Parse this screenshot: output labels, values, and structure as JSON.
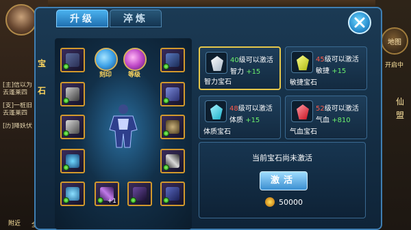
{
  "tabs": [
    {
      "label": "升级",
      "active": true
    },
    {
      "label": "淬炼",
      "active": false
    }
  ],
  "side_label": [
    "宝",
    "石"
  ],
  "orbs": [
    {
      "label": "刻印",
      "color": "#3fa3e8"
    },
    {
      "label": "等级",
      "color": "#c04ac8"
    }
  ],
  "equipment_slots": [
    {
      "name": "helmet",
      "plus": ""
    },
    {
      "name": "necklace",
      "plus": ""
    },
    {
      "name": "flag",
      "plus": ""
    },
    {
      "name": "shoulder",
      "plus": ""
    },
    {
      "name": "banner",
      "plus": ""
    },
    {
      "name": "mask",
      "plus": ""
    },
    {
      "name": "ring",
      "plus": ""
    },
    {
      "name": "sword",
      "plus": ""
    },
    {
      "name": "orb-charm",
      "plus": ""
    },
    {
      "name": "staff",
      "plus": "+1"
    },
    {
      "name": "bow",
      "plus": ""
    },
    {
      "name": "boots",
      "plus": ""
    }
  ],
  "gems": [
    {
      "name": "智力宝石",
      "level": "40",
      "condition_suffix": "级可以激活",
      "stat": "智力",
      "bonus": "+15",
      "color": "#d8e6f2",
      "level_color": "green",
      "selected": true
    },
    {
      "name": "敏捷宝石",
      "level": "45",
      "condition_suffix": "级可以激活",
      "stat": "敏捷",
      "bonus": "+15",
      "color": "#e8ec3a",
      "level_color": "red",
      "selected": false
    },
    {
      "name": "体质宝石",
      "level": "48",
      "condition_suffix": "级可以激活",
      "stat": "体质",
      "bonus": "+15",
      "color": "#3ad8e8",
      "level_color": "red",
      "selected": false
    },
    {
      "name": "气血宝石",
      "level": "52",
      "condition_suffix": "级可以激活",
      "stat": "气血",
      "bonus": "+810",
      "color": "#e8243a",
      "level_color": "red",
      "selected": false
    }
  ],
  "info": {
    "status": "当前宝石尚未激活",
    "activate_label": "激活",
    "cost": "50000"
  },
  "hud": {
    "chat": [
      {
        "tag": "[主]",
        "text": "信以为"
      },
      {
        "tag": "",
        "text": "去蓬莱四"
      },
      {
        "tag": "[支]",
        "text": "一桩旧"
      },
      {
        "tag": "",
        "text": "去蓬莱四"
      },
      {
        "tag": "[历]",
        "text": "降妖伏"
      }
    ],
    "bottom_left": [
      "附近",
      "全部"
    ],
    "right_buttons": [
      "地图",
      "开启中"
    ],
    "right_text": [
      "仙",
      "盟"
    ]
  }
}
